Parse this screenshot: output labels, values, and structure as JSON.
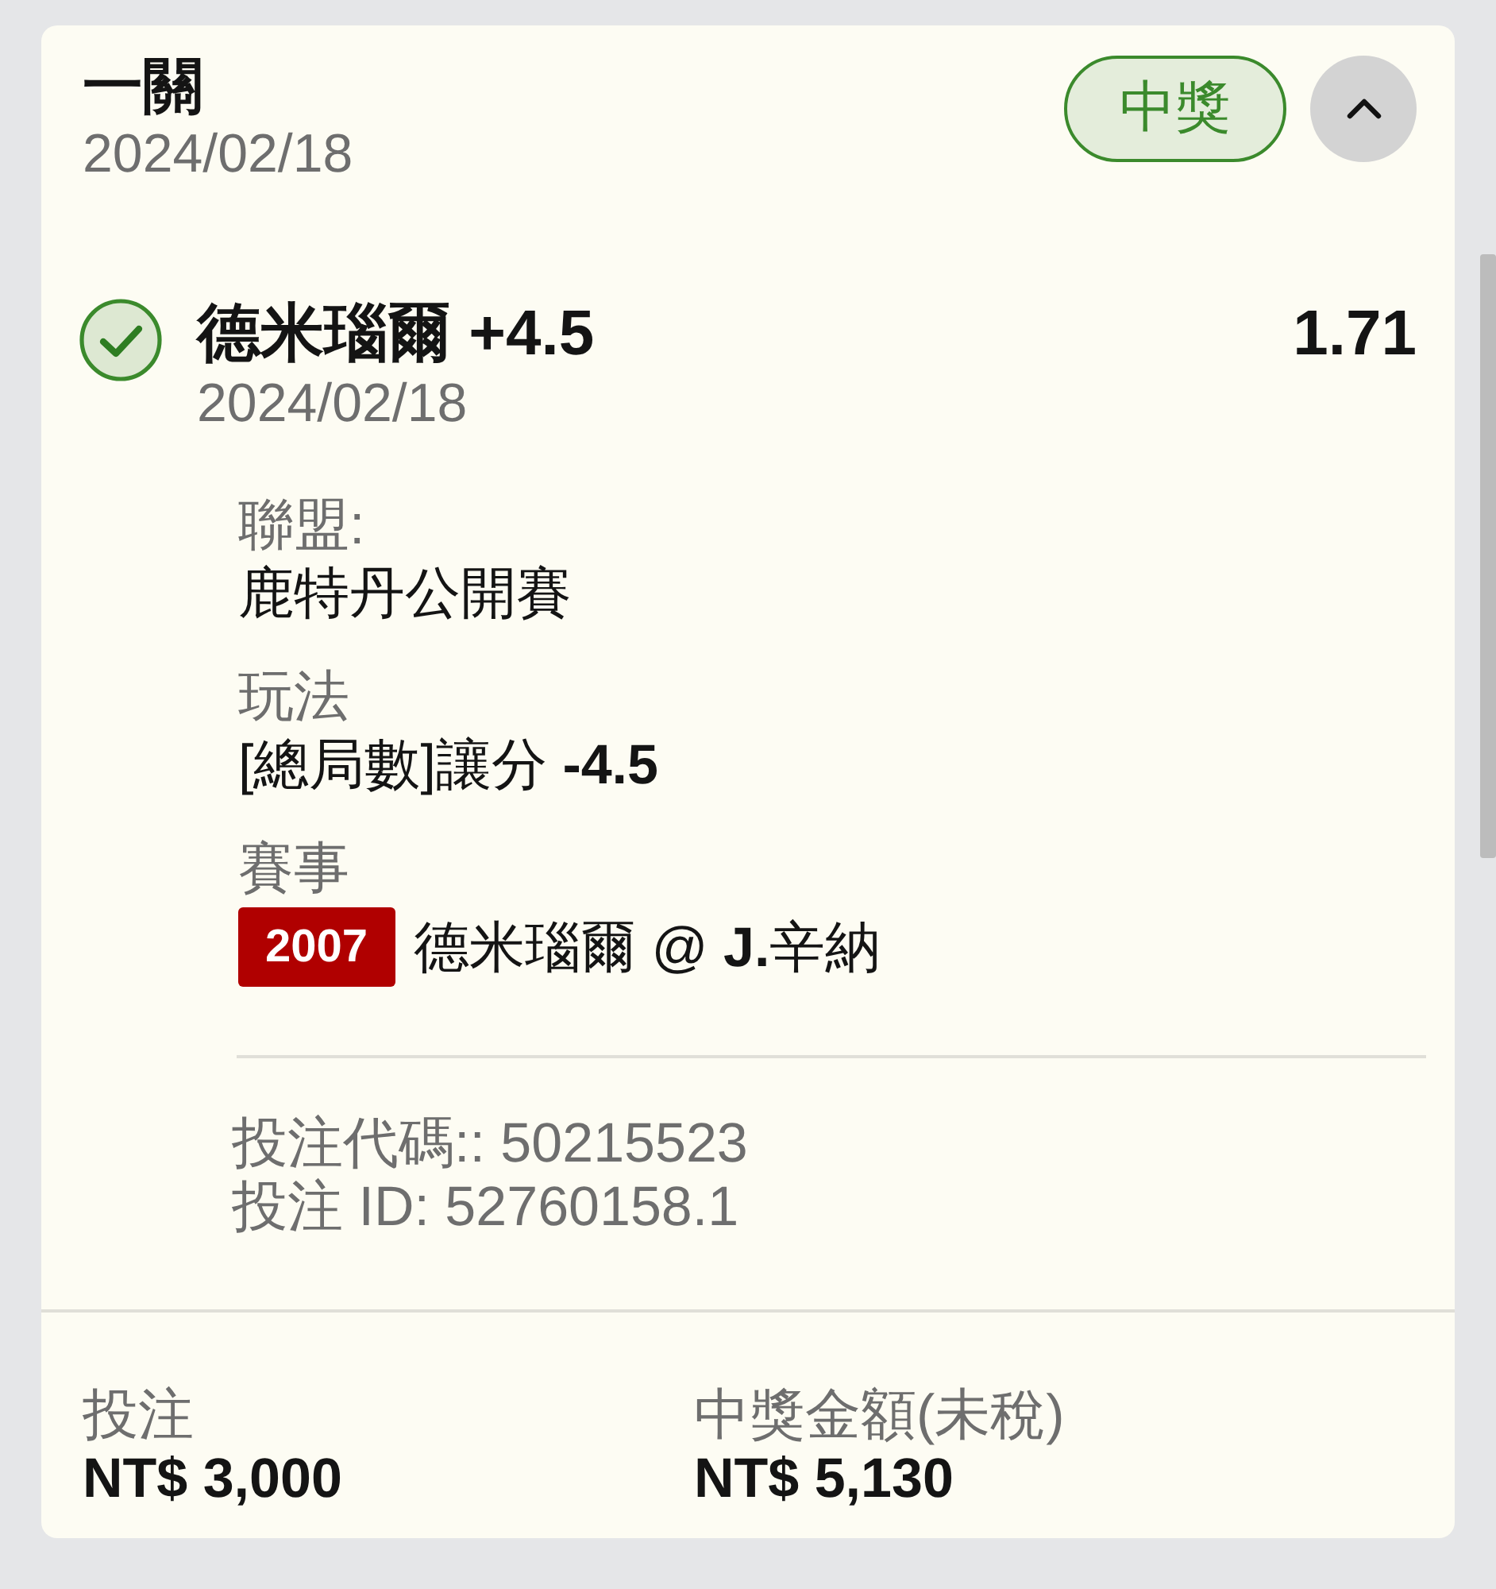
{
  "header": {
    "title": "一關",
    "date": "2024/02/18",
    "status": {
      "label": "中獎",
      "kind": "won"
    },
    "expanded": true
  },
  "selection": {
    "won": true,
    "name": "德米瑙爾 +4.5",
    "date": "2024/02/18",
    "odds": "1.71"
  },
  "details": [
    {
      "kind": "text",
      "label": "聯盟:",
      "value": "鹿特丹公開賽"
    },
    {
      "kind": "text",
      "label": "玩法",
      "value": "[總局數]讓分 **-4.5**"
    },
    {
      "kind": "event",
      "label": "賽事",
      "code": "2007",
      "value": "德米瑙爾 @ **J.**辛納"
    }
  ],
  "bet_info": [
    "投注代碼:: 50215523",
    "投注 ID: 52760158.1"
  ],
  "summary": [
    {
      "label": "投注",
      "value": "NT$ 3,000"
    },
    {
      "label": "中獎金額(未稅)",
      "value": "NT$ 5,130"
    }
  ]
}
